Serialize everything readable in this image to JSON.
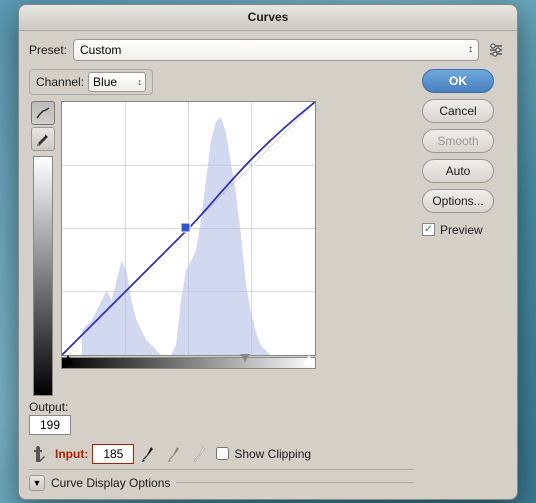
{
  "dialog": {
    "title": "Curves",
    "preset_label": "Preset:",
    "preset_value": "Custom",
    "channel_label": "Channel:",
    "channel_value": "Blue",
    "output_label": "Output:",
    "output_value": "199",
    "input_label": "Input:",
    "input_value": "185",
    "buttons": {
      "ok": "OK",
      "cancel": "Cancel",
      "smooth": "Smooth",
      "auto": "Auto",
      "options": "Options..."
    },
    "preview_label": "Preview",
    "preview_checked": true,
    "show_clipping_label": "Show Clipping",
    "curve_display_options_label": "Curve Display Options"
  }
}
